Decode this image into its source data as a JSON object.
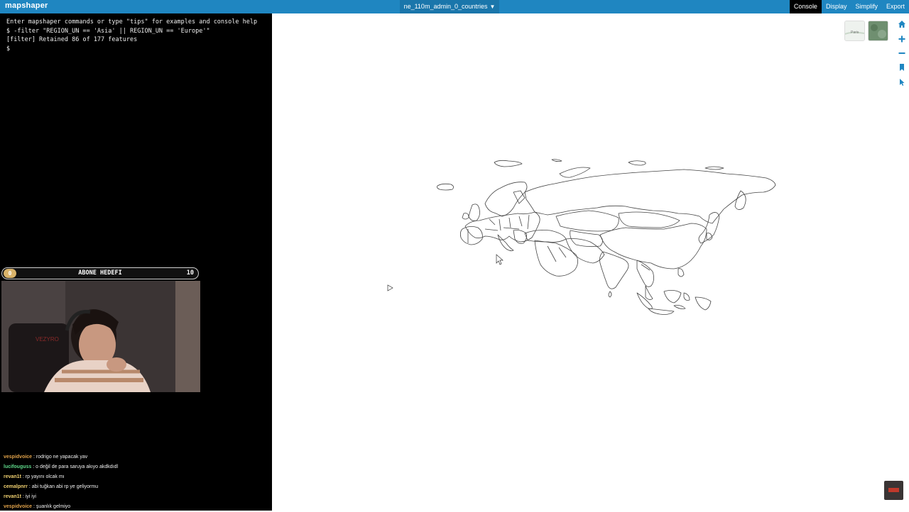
{
  "app": {
    "name": "mapshaper"
  },
  "layer": {
    "name": "ne_110m_admin_0_countries",
    "arrow": "▼"
  },
  "menu": {
    "items": [
      "Console",
      "Display",
      "Simplify",
      "Export"
    ]
  },
  "console": {
    "lines": [
      "Enter mapshaper commands or type \"tips\" for examples and console help",
      "$ -filter \"REGION_UN == 'Asia' || REGION_UN == 'Europe'\"",
      "[filter] Retained 86 of 177 features",
      "$"
    ]
  },
  "overlay": {
    "goal_title": "ABONE HEDEFI",
    "goal_current": "0",
    "goal_target": "10",
    "progress": 0.0
  },
  "chat": [
    {
      "user": "vespidvoice",
      "color": "#e0a24a",
      "text": ": rodrigo ne yapacak yav"
    },
    {
      "user": "lucifouguss",
      "color": "#5fd98a",
      "text": ": o değil de para saruya akıyo akdkdıdl"
    },
    {
      "user": "revan1t",
      "color": "#f0d070",
      "text": ": rp yayını olcak mı"
    },
    {
      "user": "cemalpnrr",
      "color": "#f0d070",
      "text": ": abi tuğkan abi rp ye geliyormu"
    },
    {
      "user": "revan1t",
      "color": "#f0d070",
      "text": ": iyi iyi"
    },
    {
      "user": "vespidvoice",
      "color": "#e0a24a",
      "text": ": şuanlık gelmiyo"
    }
  ],
  "basemap": {
    "thumb_light_label": "Paris"
  },
  "map_tools": [
    "home-icon",
    "zoom-in-icon",
    "zoom-out-icon",
    "bookmark-icon",
    "pointer-icon"
  ],
  "colors": {
    "accent": "#1f86c1",
    "console_bg": "#000000",
    "map_stroke": "#444444"
  }
}
